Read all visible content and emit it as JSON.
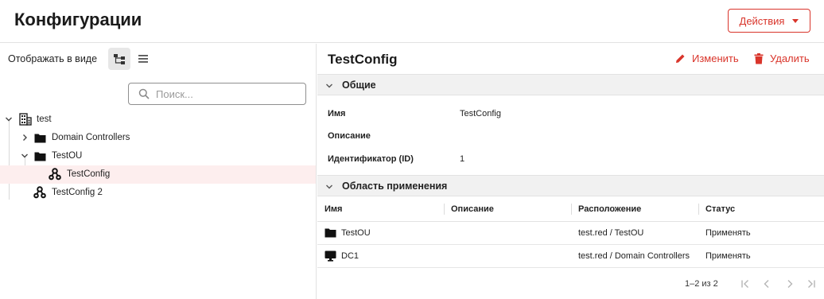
{
  "header": {
    "title": "Конфигурации",
    "actions_label": "Действия"
  },
  "left": {
    "view_label": "Отображать в виде",
    "search_placeholder": "Поиск...",
    "tree": [
      {
        "label": "test",
        "icon": "building-icon",
        "expanded": true
      },
      {
        "label": "Domain Controllers",
        "icon": "folder-icon",
        "expanded": false
      },
      {
        "label": "TestOU",
        "icon": "folder-icon",
        "expanded": true
      },
      {
        "label": "TestConfig",
        "icon": "config-icon",
        "selected": true
      },
      {
        "label": "TestConfig 2",
        "icon": "config-icon"
      }
    ]
  },
  "detail": {
    "title": "TestConfig",
    "edit_label": "Изменить",
    "delete_label": "Удалить",
    "general_section": "Общие",
    "props": [
      {
        "label": "Имя",
        "value": "TestConfig"
      },
      {
        "label": "Описание",
        "value": ""
      },
      {
        "label": "Идентификатор (ID)",
        "value": "1"
      }
    ],
    "scope_section": "Область применения",
    "columns": [
      "Имя",
      "Описание",
      "Расположение",
      "Статус"
    ],
    "rows": [
      {
        "icon": "folder-icon",
        "name": "TestOU",
        "description": "",
        "location": "test.red / TestOU",
        "status": "Применять"
      },
      {
        "icon": "monitor-icon",
        "name": "DC1",
        "description": "",
        "location": "test.red / Domain Controllers",
        "status": "Применять"
      }
    ],
    "pagination": "1–2 из 2"
  },
  "colors": {
    "accent": "#d9352b",
    "selected_row": "#fdeeee",
    "section_bg": "#f1f1f1"
  }
}
